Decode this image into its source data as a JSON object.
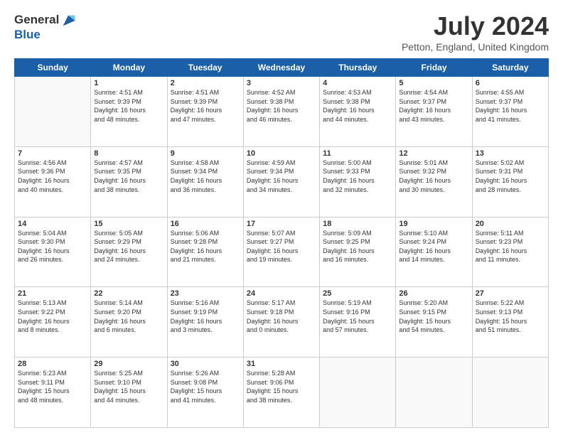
{
  "logo": {
    "general": "General",
    "blue": "Blue"
  },
  "title": "July 2024",
  "location": "Petton, England, United Kingdom",
  "days_of_week": [
    "Sunday",
    "Monday",
    "Tuesday",
    "Wednesday",
    "Thursday",
    "Friday",
    "Saturday"
  ],
  "weeks": [
    [
      {
        "day": "",
        "info": ""
      },
      {
        "day": "1",
        "info": "Sunrise: 4:51 AM\nSunset: 9:39 PM\nDaylight: 16 hours\nand 48 minutes."
      },
      {
        "day": "2",
        "info": "Sunrise: 4:51 AM\nSunset: 9:39 PM\nDaylight: 16 hours\nand 47 minutes."
      },
      {
        "day": "3",
        "info": "Sunrise: 4:52 AM\nSunset: 9:38 PM\nDaylight: 16 hours\nand 46 minutes."
      },
      {
        "day": "4",
        "info": "Sunrise: 4:53 AM\nSunset: 9:38 PM\nDaylight: 16 hours\nand 44 minutes."
      },
      {
        "day": "5",
        "info": "Sunrise: 4:54 AM\nSunset: 9:37 PM\nDaylight: 16 hours\nand 43 minutes."
      },
      {
        "day": "6",
        "info": "Sunrise: 4:55 AM\nSunset: 9:37 PM\nDaylight: 16 hours\nand 41 minutes."
      }
    ],
    [
      {
        "day": "7",
        "info": "Sunrise: 4:56 AM\nSunset: 9:36 PM\nDaylight: 16 hours\nand 40 minutes."
      },
      {
        "day": "8",
        "info": "Sunrise: 4:57 AM\nSunset: 9:35 PM\nDaylight: 16 hours\nand 38 minutes."
      },
      {
        "day": "9",
        "info": "Sunrise: 4:58 AM\nSunset: 9:34 PM\nDaylight: 16 hours\nand 36 minutes."
      },
      {
        "day": "10",
        "info": "Sunrise: 4:59 AM\nSunset: 9:34 PM\nDaylight: 16 hours\nand 34 minutes."
      },
      {
        "day": "11",
        "info": "Sunrise: 5:00 AM\nSunset: 9:33 PM\nDaylight: 16 hours\nand 32 minutes."
      },
      {
        "day": "12",
        "info": "Sunrise: 5:01 AM\nSunset: 9:32 PM\nDaylight: 16 hours\nand 30 minutes."
      },
      {
        "day": "13",
        "info": "Sunrise: 5:02 AM\nSunset: 9:31 PM\nDaylight: 16 hours\nand 28 minutes."
      }
    ],
    [
      {
        "day": "14",
        "info": "Sunrise: 5:04 AM\nSunset: 9:30 PM\nDaylight: 16 hours\nand 26 minutes."
      },
      {
        "day": "15",
        "info": "Sunrise: 5:05 AM\nSunset: 9:29 PM\nDaylight: 16 hours\nand 24 minutes."
      },
      {
        "day": "16",
        "info": "Sunrise: 5:06 AM\nSunset: 9:28 PM\nDaylight: 16 hours\nand 21 minutes."
      },
      {
        "day": "17",
        "info": "Sunrise: 5:07 AM\nSunset: 9:27 PM\nDaylight: 16 hours\nand 19 minutes."
      },
      {
        "day": "18",
        "info": "Sunrise: 5:09 AM\nSunset: 9:25 PM\nDaylight: 16 hours\nand 16 minutes."
      },
      {
        "day": "19",
        "info": "Sunrise: 5:10 AM\nSunset: 9:24 PM\nDaylight: 16 hours\nand 14 minutes."
      },
      {
        "day": "20",
        "info": "Sunrise: 5:11 AM\nSunset: 9:23 PM\nDaylight: 16 hours\nand 11 minutes."
      }
    ],
    [
      {
        "day": "21",
        "info": "Sunrise: 5:13 AM\nSunset: 9:22 PM\nDaylight: 16 hours\nand 8 minutes."
      },
      {
        "day": "22",
        "info": "Sunrise: 5:14 AM\nSunset: 9:20 PM\nDaylight: 16 hours\nand 6 minutes."
      },
      {
        "day": "23",
        "info": "Sunrise: 5:16 AM\nSunset: 9:19 PM\nDaylight: 16 hours\nand 3 minutes."
      },
      {
        "day": "24",
        "info": "Sunrise: 5:17 AM\nSunset: 9:18 PM\nDaylight: 16 hours\nand 0 minutes."
      },
      {
        "day": "25",
        "info": "Sunrise: 5:19 AM\nSunset: 9:16 PM\nDaylight: 15 hours\nand 57 minutes."
      },
      {
        "day": "26",
        "info": "Sunrise: 5:20 AM\nSunset: 9:15 PM\nDaylight: 15 hours\nand 54 minutes."
      },
      {
        "day": "27",
        "info": "Sunrise: 5:22 AM\nSunset: 9:13 PM\nDaylight: 15 hours\nand 51 minutes."
      }
    ],
    [
      {
        "day": "28",
        "info": "Sunrise: 5:23 AM\nSunset: 9:11 PM\nDaylight: 15 hours\nand 48 minutes."
      },
      {
        "day": "29",
        "info": "Sunrise: 5:25 AM\nSunset: 9:10 PM\nDaylight: 15 hours\nand 44 minutes."
      },
      {
        "day": "30",
        "info": "Sunrise: 5:26 AM\nSunset: 9:08 PM\nDaylight: 15 hours\nand 41 minutes."
      },
      {
        "day": "31",
        "info": "Sunrise: 5:28 AM\nSunset: 9:06 PM\nDaylight: 15 hours\nand 38 minutes."
      },
      {
        "day": "",
        "info": ""
      },
      {
        "day": "",
        "info": ""
      },
      {
        "day": "",
        "info": ""
      }
    ]
  ]
}
